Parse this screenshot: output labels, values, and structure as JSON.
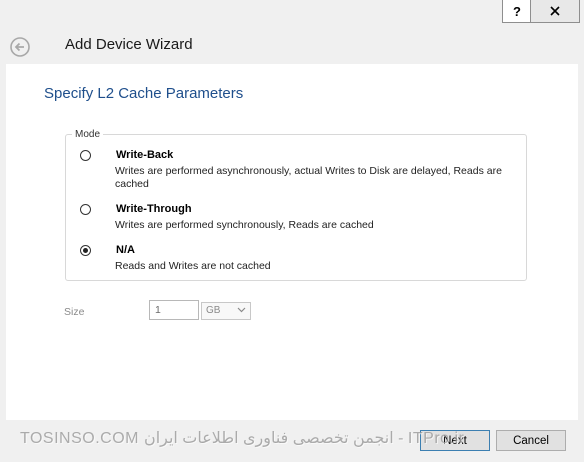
{
  "window": {
    "help_label": "?",
    "close_icon": "close-icon"
  },
  "header": {
    "title": "Add Device Wizard",
    "back_icon": "back-arrow-icon"
  },
  "page": {
    "heading": "Specify L2 Cache Parameters"
  },
  "mode": {
    "legend": "Mode",
    "options": [
      {
        "title": "Write-Back",
        "description": "Writes are performed asynchronously, actual Writes to Disk are delayed, Reads are cached",
        "selected": false
      },
      {
        "title": "Write-Through",
        "description": "Writes are performed synchronously, Reads are cached",
        "selected": false
      },
      {
        "title": "N/A",
        "description": "Reads and Writes are not cached",
        "selected": true
      }
    ]
  },
  "size": {
    "label": "Size",
    "value": "1",
    "unit": "GB"
  },
  "footer": {
    "next_label": "Next",
    "cancel_label": "Cancel"
  },
  "watermark": {
    "text": "TOSINSO.COM انجمن تخصصی فناوری اطلاعات ایران - ITPro.ir"
  },
  "colors": {
    "heading": "#1f4f8c",
    "content_bg": "#ffffff",
    "chrome_bg": "#f0f0f0",
    "button_focus_border": "#3c7fb1"
  }
}
